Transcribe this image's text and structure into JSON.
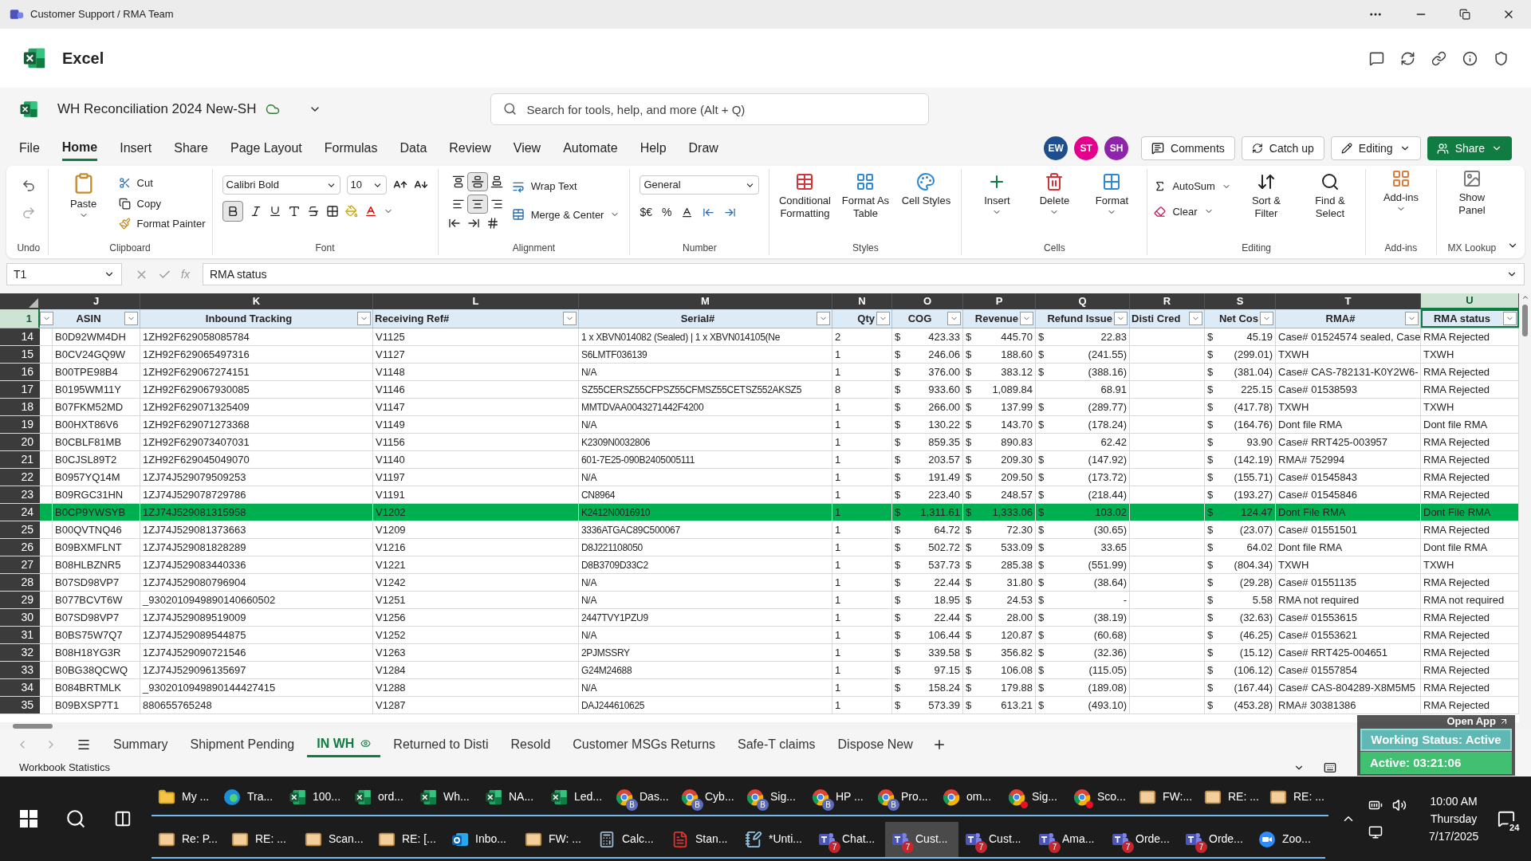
{
  "window": {
    "title": "Customer Support / RMA Team"
  },
  "app": {
    "name": "Excel"
  },
  "document": {
    "title": "WH Reconciliation 2024 New-SH"
  },
  "search": {
    "placeholder": "Search for tools, help, and more (Alt + Q)"
  },
  "menu_tabs": [
    {
      "label": "File",
      "selected": false
    },
    {
      "label": "Home",
      "selected": true
    },
    {
      "label": "Insert",
      "selected": false
    },
    {
      "label": "Share",
      "selected": false
    },
    {
      "label": "Page Layout",
      "selected": false
    },
    {
      "label": "Formulas",
      "selected": false
    },
    {
      "label": "Data",
      "selected": false
    },
    {
      "label": "Review",
      "selected": false
    },
    {
      "label": "View",
      "selected": false
    },
    {
      "label": "Automate",
      "selected": false
    },
    {
      "label": "Help",
      "selected": false
    },
    {
      "label": "Draw",
      "selected": false
    }
  ],
  "avatars": [
    {
      "initials": "EW",
      "color": "#1f4e8c"
    },
    {
      "initials": "ST",
      "color": "#e3008c"
    },
    {
      "initials": "SH",
      "color": "#8e24aa"
    }
  ],
  "header_buttons": [
    {
      "kind": "comments",
      "label": "Comments"
    },
    {
      "kind": "catchup",
      "label": "Catch up"
    },
    {
      "kind": "editing",
      "label": "Editing"
    },
    {
      "kind": "share",
      "label": "Share"
    }
  ],
  "ribbon": {
    "undo_label": "Undo",
    "clipboard": {
      "paste": "Paste",
      "items": [
        "Cut",
        "Copy",
        "Format Painter"
      ],
      "label": "Clipboard"
    },
    "font": {
      "name": "Calibri Bold",
      "size": "10",
      "bold": true,
      "label": "Font"
    },
    "alignment": {
      "wrap": "Wrap Text",
      "merge": "Merge & Center",
      "vertical": [
        {
          "selected": false
        },
        {
          "selected": true
        },
        {
          "selected": false
        }
      ],
      "horizontal": [
        {
          "selected": false
        },
        {
          "selected": true
        },
        {
          "selected": false
        }
      ],
      "label": "Alignment"
    },
    "number": {
      "format": "General",
      "symbols": [
        "$€",
        "%"
      ],
      "label": "Number"
    },
    "styles": {
      "buttons": [
        "Conditional Formatting",
        "Format As Table",
        "Cell Styles"
      ],
      "label": "Styles"
    },
    "cells": {
      "buttons": [
        "Insert",
        "Delete",
        "Format"
      ],
      "label": "Cells"
    },
    "editing": {
      "autosum": "AutoSum",
      "clear": "Clear",
      "buttons": [
        "Sort & Filter",
        "Find & Select"
      ],
      "label": "Editing"
    },
    "addins": {
      "button": "Add-ins",
      "label": "Add-ins"
    },
    "mx": {
      "button": "Show Panel",
      "label": "MX Lookup"
    }
  },
  "formula_bar": {
    "cell_ref": "T1",
    "function_symbol": "fx",
    "formula": "RMA status"
  },
  "grid": {
    "header_row": "1",
    "columns": [
      {
        "letter": "J",
        "heading": "ASIN",
        "selected": false
      },
      {
        "letter": "K",
        "heading": "Inbound Tracking",
        "selected": false
      },
      {
        "letter": "L",
        "heading": "Receiving Ref#",
        "selected": false
      },
      {
        "letter": "M",
        "heading": "Serial#",
        "selected": false
      },
      {
        "letter": "N",
        "heading": "Qty",
        "selected": false
      },
      {
        "letter": "O",
        "heading": "COG",
        "selected": false
      },
      {
        "letter": "P",
        "heading": "Revenue",
        "selected": false
      },
      {
        "letter": "Q",
        "heading": "Refund Issue",
        "selected": false
      },
      {
        "letter": "R",
        "heading": "Disti Cred",
        "selected": false
      },
      {
        "letter": "S",
        "heading": "Net Cos",
        "selected": false
      },
      {
        "letter": "T",
        "heading": "RMA#",
        "selected": false
      },
      {
        "letter": "U",
        "heading": "RMA status",
        "selected": true
      }
    ],
    "rows": [
      {
        "num": "14",
        "asin": "B0D92WM4DH",
        "tracking": "1ZH92F629058085784",
        "ref": "V1125",
        "serial": "1 x XBVN014082 (Sealed) | 1 x XBVN014105(Ne",
        "qty": "2",
        "cog": [
          "$",
          "423.33"
        ],
        "revenue": [
          "$",
          "445.70"
        ],
        "refund": [
          "$",
          "22.83"
        ],
        "net": [
          "$",
          "45.19"
        ],
        "rma": "Case# 01524574 sealed, Case",
        "status": "RMA Rejected",
        "highlighted": false
      },
      {
        "num": "15",
        "asin": "B0CV24GQ9W",
        "tracking": "1ZH92F629065497316",
        "ref": "V1127",
        "serial": "S6LMTF036139",
        "qty": "1",
        "cog": [
          "$",
          "246.06"
        ],
        "revenue": [
          "$",
          "188.60"
        ],
        "refund": [
          "$",
          "(241.55)"
        ],
        "net": [
          "$",
          "(299.01)"
        ],
        "rma": "TXWH",
        "status": "TXWH",
        "highlighted": false
      },
      {
        "num": "16",
        "asin": "B00TPE98B4",
        "tracking": "1ZH92F629067274151",
        "ref": "V1148",
        "serial": "N/A",
        "qty": "1",
        "cog": [
          "$",
          "376.00"
        ],
        "revenue": [
          "$",
          "383.12"
        ],
        "refund": [
          "$",
          "(388.16)"
        ],
        "net": [
          "$",
          "(381.04)"
        ],
        "rma": "Case# CAS-782131-K0Y2W6-",
        "status": "RMA Rejected",
        "highlighted": false
      },
      {
        "num": "17",
        "asin": "B0195WM11Y",
        "tracking": "1ZH92F629067930085",
        "ref": "V1146",
        "serial": "SZ55CERSZ55CFPSZ55CFMSZ55CETSZ552AKSZ5",
        "qty": "8",
        "cog": [
          "$",
          "933.60"
        ],
        "revenue": [
          "$",
          "1,089.84"
        ],
        "refund": [
          "68.91"
        ],
        "net": [
          "$",
          "225.15"
        ],
        "rma": "Case# 01538593",
        "status": "RMA Rejected",
        "highlighted": false
      },
      {
        "num": "18",
        "asin": "B07FKM52MD",
        "tracking": "1ZH92F629071325409",
        "ref": "V1147",
        "serial": "MMTDVAA0043271442F4200",
        "qty": "1",
        "cog": [
          "$",
          "266.00"
        ],
        "revenue": [
          "$",
          "137.99"
        ],
        "refund": [
          "$",
          "(289.77)"
        ],
        "net": [
          "$",
          "(417.78)"
        ],
        "rma": "TXWH",
        "status": "TXWH",
        "highlighted": false
      },
      {
        "num": "19",
        "asin": "B00HXT86V6",
        "tracking": "1ZH92F629071273368",
        "ref": "V1149",
        "serial": "N/A",
        "qty": "1",
        "cog": [
          "$",
          "130.22"
        ],
        "revenue": [
          "$",
          "143.70"
        ],
        "refund": [
          "$",
          "(178.24)"
        ],
        "net": [
          "$",
          "(164.76)"
        ],
        "rma": "Dont file RMA",
        "status": "Dont file RMA",
        "highlighted": false
      },
      {
        "num": "20",
        "asin": "B0CBLF81MB",
        "tracking": "1ZH92F629073407031",
        "ref": "V1156",
        "serial": "K2309N0032806",
        "qty": "1",
        "cog": [
          "$",
          "859.35"
        ],
        "revenue": [
          "$",
          "890.83"
        ],
        "refund": [
          "62.42"
        ],
        "net": [
          "$",
          "93.90"
        ],
        "rma": "Case# RRT425-003957",
        "status": "RMA Rejected",
        "highlighted": false
      },
      {
        "num": "21",
        "asin": "B0CJSL89T2",
        "tracking": "1ZH92F629045049070",
        "ref": "V1140",
        "serial": "601-7E25-090B2405005111",
        "qty": "1",
        "cog": [
          "$",
          "203.57"
        ],
        "revenue": [
          "$",
          "209.30"
        ],
        "refund": [
          "$",
          "(147.92)"
        ],
        "net": [
          "$",
          "(142.19)"
        ],
        "rma": "RMA# 752994",
        "status": "RMA Rejected",
        "highlighted": false
      },
      {
        "num": "22",
        "asin": "B0957YQ14M",
        "tracking": "1ZJ74J529079509253",
        "ref": "V1197",
        "serial": "N/A",
        "qty": "1",
        "cog": [
          "$",
          "191.49"
        ],
        "revenue": [
          "$",
          "209.50"
        ],
        "refund": [
          "$",
          "(173.72)"
        ],
        "net": [
          "$",
          "(155.71)"
        ],
        "rma": "Case# 01545843",
        "status": "RMA Rejected",
        "highlighted": false
      },
      {
        "num": "23",
        "asin": "B09RGC31HN",
        "tracking": "1ZJ74J529078729786",
        "ref": "V1191",
        "serial": "CN8964",
        "qty": "1",
        "cog": [
          "$",
          "223.40"
        ],
        "revenue": [
          "$",
          "248.57"
        ],
        "refund": [
          "$",
          "(218.44)"
        ],
        "net": [
          "$",
          "(193.27)"
        ],
        "rma": "Case# 01545846",
        "status": "RMA Rejected",
        "highlighted": false
      },
      {
        "num": "24",
        "asin": "B0CP9YWSYB",
        "tracking": "1ZJ74J529081315958",
        "ref": "V1202",
        "serial": "K2412N0016910",
        "qty": "1",
        "cog": [
          "$",
          "1,311.61"
        ],
        "revenue": [
          "$",
          "1,333.06"
        ],
        "refund": [
          "$",
          "103.02"
        ],
        "net": [
          "$",
          "124.47"
        ],
        "rma": "Dont File RMA",
        "status": "Dont File RMA",
        "highlighted": true
      },
      {
        "num": "25",
        "asin": "B00QVTNQ46",
        "tracking": "1ZJ74J529081373663",
        "ref": "V1209",
        "serial": "3336ATGAC89C500067",
        "qty": "1",
        "cog": [
          "$",
          "64.72"
        ],
        "revenue": [
          "$",
          "72.30"
        ],
        "refund": [
          "$",
          "(30.65)"
        ],
        "net": [
          "$",
          "(23.07)"
        ],
        "rma": "Case# 01551501",
        "status": "RMA Rejected",
        "highlighted": false
      },
      {
        "num": "26",
        "asin": "B09BXMFLNT",
        "tracking": "1ZJ74J529081828289",
        "ref": "V1216",
        "serial": "D8J221108050",
        "qty": "1",
        "cog": [
          "$",
          "502.72"
        ],
        "revenue": [
          "$",
          "533.09"
        ],
        "refund": [
          "$",
          "33.65"
        ],
        "net": [
          "$",
          "64.02"
        ],
        "rma": "Dont file RMA",
        "status": "Dont file RMA",
        "highlighted": false
      },
      {
        "num": "27",
        "asin": "B08HLBZNR5",
        "tracking": "1ZJ74J529083440336",
        "ref": "V1221",
        "serial": "D8B3709D33C2",
        "qty": "1",
        "cog": [
          "$",
          "537.73"
        ],
        "revenue": [
          "$",
          "285.38"
        ],
        "refund": [
          "$",
          "(551.99)"
        ],
        "net": [
          "$",
          "(804.34)"
        ],
        "rma": "TXWH",
        "status": "TXWH",
        "highlighted": false
      },
      {
        "num": "28",
        "asin": "B07SD98VP7",
        "tracking": "1ZJ74J529080796904",
        "ref": "V1242",
        "serial": "N/A",
        "qty": "1",
        "cog": [
          "$",
          "22.44"
        ],
        "revenue": [
          "$",
          "31.80"
        ],
        "refund": [
          "$",
          "(38.64)"
        ],
        "net": [
          "$",
          "(29.28)"
        ],
        "rma": "Case# 01551135",
        "status": "RMA Rejected",
        "highlighted": false
      },
      {
        "num": "29",
        "asin": "B077BCVT6W",
        "tracking": "_9302010949890140660502",
        "ref": "V1251",
        "serial": "N/A",
        "qty": "1",
        "cog": [
          "$",
          "18.95"
        ],
        "revenue": [
          "$",
          "24.53"
        ],
        "refund": [
          "$",
          "-"
        ],
        "net": [
          "$",
          "5.58"
        ],
        "rma": "RMA not required",
        "status": "RMA not required",
        "highlighted": false
      },
      {
        "num": "30",
        "asin": "B07SD98VP7",
        "tracking": "1ZJ74J529089519009",
        "ref": "V1256",
        "serial": "2447TVY1PZU9",
        "qty": "1",
        "cog": [
          "$",
          "22.44"
        ],
        "revenue": [
          "$",
          "28.00"
        ],
        "refund": [
          "$",
          "(38.19)"
        ],
        "net": [
          "$",
          "(32.63)"
        ],
        "rma": "Case# 01553615",
        "status": "RMA Rejected",
        "highlighted": false
      },
      {
        "num": "31",
        "asin": "B0BS75W7Q7",
        "tracking": "1ZJ74J529089544875",
        "ref": "V1252",
        "serial": "N/A",
        "qty": "1",
        "cog": [
          "$",
          "106.44"
        ],
        "revenue": [
          "$",
          "120.87"
        ],
        "refund": [
          "$",
          "(60.68)"
        ],
        "net": [
          "$",
          "(46.25)"
        ],
        "rma": "Case# 01553621",
        "status": "RMA Rejected",
        "highlighted": false
      },
      {
        "num": "32",
        "asin": "B08H18YG3R",
        "tracking": "1ZJ74J529090721546",
        "ref": "V1263",
        "serial": "2PJMSSRY",
        "qty": "1",
        "cog": [
          "$",
          "339.58"
        ],
        "revenue": [
          "$",
          "356.82"
        ],
        "refund": [
          "$",
          "(32.36)"
        ],
        "net": [
          "$",
          "(15.12)"
        ],
        "rma": "Case# RRT425-004651",
        "status": "RMA Rejected",
        "highlighted": false
      },
      {
        "num": "33",
        "asin": "B0BG38QCWQ",
        "tracking": "1ZJ74J529096135697",
        "ref": "V1284",
        "serial": "G24M24688",
        "qty": "1",
        "cog": [
          "$",
          "97.15"
        ],
        "revenue": [
          "$",
          "106.08"
        ],
        "refund": [
          "$",
          "(115.05)"
        ],
        "net": [
          "$",
          "(106.12)"
        ],
        "rma": "Case# 01557854",
        "status": "RMA Rejected",
        "highlighted": false
      },
      {
        "num": "34",
        "asin": "B084BRTMLK",
        "tracking": "_9302010949890144427415",
        "ref": "V1288",
        "serial": "N/A",
        "qty": "1",
        "cog": [
          "$",
          "158.24"
        ],
        "revenue": [
          "$",
          "179.88"
        ],
        "refund": [
          "$",
          "(189.08)"
        ],
        "net": [
          "$",
          "(167.44)"
        ],
        "rma": "Case# CAS-804289-X8M5M5",
        "status": "RMA Rejected",
        "highlighted": false
      },
      {
        "num": "35",
        "asin": "B09BXSP7T1",
        "tracking": "880655765248",
        "ref": "V1287",
        "serial": "DAJ244610625",
        "qty": "1",
        "cog": [
          "$",
          "573.39"
        ],
        "revenue": [
          "$",
          "613.21"
        ],
        "refund": [
          "$",
          "(493.10)"
        ],
        "net": [
          "$",
          "(453.28)"
        ],
        "rma": "RMA# 30381386",
        "status": "RMA Rejected",
        "highlighted": false
      }
    ]
  },
  "sheet_tabs": [
    {
      "label": "Summary",
      "selected": false
    },
    {
      "label": "Shipment Pending",
      "selected": false
    },
    {
      "label": "IN WH",
      "selected": true
    },
    {
      "label": "Returned to Disti",
      "selected": false
    },
    {
      "label": "Resold",
      "selected": false
    },
    {
      "label": "Customer MSGs Returns",
      "selected": false
    },
    {
      "label": "Safe-T claims",
      "selected": false
    },
    {
      "label": "Dispose New",
      "selected": false
    }
  ],
  "status_bar": {
    "text": "Workbook Statistics"
  },
  "overlay": {
    "open_app": "Open App",
    "working_status": "Working Status: Active",
    "active_time": "Active: 03:21:06"
  },
  "taskbar": {
    "top_row": [
      {
        "kind": "folder",
        "label": "My ...",
        "selected": false
      },
      {
        "kind": "edge",
        "label": "Tra...",
        "selected": false
      },
      {
        "kind": "excel",
        "label": "100...",
        "selected": false
      },
      {
        "kind": "excel",
        "label": "ord...",
        "selected": false
      },
      {
        "kind": "excel",
        "label": "Wh...",
        "selected": false
      },
      {
        "kind": "excel",
        "label": "NA...",
        "selected": false
      },
      {
        "kind": "excel",
        "label": "Led...",
        "selected": false
      },
      {
        "kind": "chrome",
        "label": "Das...",
        "badge": "B",
        "selected": false
      },
      {
        "kind": "chrome",
        "label": "Cyb...",
        "badge": "B",
        "selected": false
      },
      {
        "kind": "chrome",
        "label": "Sig...",
        "badge": "B",
        "selected": false
      },
      {
        "kind": "chrome",
        "label": "HP ...",
        "badge": "B",
        "selected": false
      },
      {
        "kind": "chrome",
        "label": "Pro...",
        "badge": "B",
        "selected": false
      },
      {
        "kind": "chrome",
        "label": "om...",
        "selected": false
      },
      {
        "kind": "chrome",
        "label": "Sig...",
        "dot": true,
        "selected": false
      },
      {
        "kind": "chrome",
        "label": "Sco...",
        "dot": true,
        "selected": false
      },
      {
        "kind": "mail",
        "label": "FW:...",
        "selected": false
      },
      {
        "kind": "mail",
        "label": "RE: ...",
        "selected": false
      },
      {
        "kind": "mail",
        "label": "RE: ...",
        "selected": false
      }
    ],
    "bottom_row": [
      {
        "kind": "mail",
        "label": "Re: P...",
        "selected": false
      },
      {
        "kind": "mail",
        "label": "RE: ...",
        "selected": false
      },
      {
        "kind": "mail",
        "label": "Scan...",
        "selected": false
      },
      {
        "kind": "mail",
        "label": "RE: [...",
        "selected": false
      },
      {
        "kind": "outlook",
        "label": "Inbo...",
        "selected": false
      },
      {
        "kind": "mail",
        "label": "FW: ...",
        "selected": false
      },
      {
        "kind": "calc",
        "label": "Calc...",
        "selected": false
      },
      {
        "kind": "pdf",
        "label": "Stan...",
        "selected": false
      },
      {
        "kind": "notepad",
        "label": "*Unti...",
        "selected": false
      },
      {
        "kind": "teams",
        "label": "Chat...",
        "badge": "7",
        "selected": false
      },
      {
        "kind": "teams",
        "label": "Cust...",
        "badge": "7",
        "selected": true
      },
      {
        "kind": "teams",
        "label": "Cust...",
        "badge": "7",
        "selected": false
      },
      {
        "kind": "teams",
        "label": "Ama...",
        "badge": "7",
        "selected": false
      },
      {
        "kind": "teams",
        "label": "Orde...",
        "badge": "7",
        "selected": false
      },
      {
        "kind": "teams",
        "label": "Orde...",
        "badge": "7",
        "selected": false
      },
      {
        "kind": "zoom",
        "label": "Zoo...",
        "selected": false
      }
    ],
    "time": "10:00 AM",
    "day": "Thursday",
    "date": "7/17/2025",
    "notifications": "24"
  }
}
